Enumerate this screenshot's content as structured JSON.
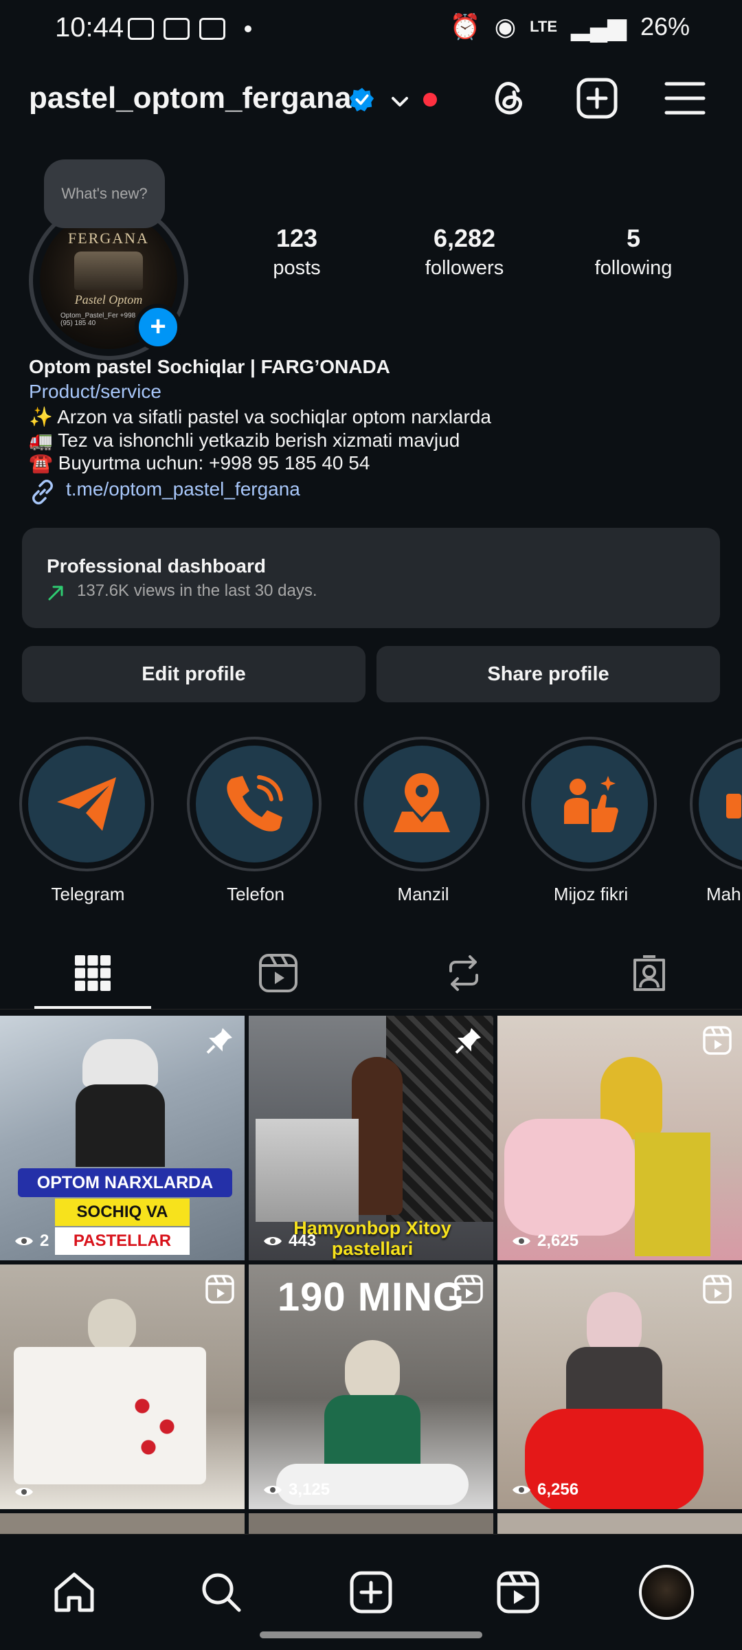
{
  "status_bar": {
    "time": "10:44",
    "network": "LTE",
    "battery": "26%"
  },
  "header": {
    "username": "pastel_optom_fergana",
    "unread_dot_color": "#ff3040"
  },
  "profile": {
    "avatar_brand": "FERGANA",
    "avatar_name": "Pastel Optom",
    "avatar_sub": "Optom_Pastel_Fer +998 (95) 185 40",
    "note_bubble": "What's new?",
    "stats": [
      {
        "value": "123",
        "label": "posts"
      },
      {
        "value": "6,282",
        "label": "followers"
      },
      {
        "value": "5",
        "label": "following"
      }
    ]
  },
  "bio": {
    "name": "Optom pastel Sochiqlar | FARG’ONADA",
    "category": "Product/service",
    "line1": "✨ Arzon va sifatli pastel va sochiqlar optom narxlarda",
    "line2": "🚛 Tez va ishonchli yetkazib berish xizmati mavjud",
    "line3": "☎️ Buyurtma uchun: +998 95 185 40 54",
    "link": "t.me/optom_pastel_fergana"
  },
  "dashboard": {
    "title": "Professional dashboard",
    "subtitle": "137.6K views in the last 30 days."
  },
  "buttons": {
    "edit": "Edit profile",
    "share": "Share profile"
  },
  "highlights": [
    {
      "label": "Telegram",
      "icon": "paper-plane-icon"
    },
    {
      "label": "Telefon",
      "icon": "phone-icon"
    },
    {
      "label": "Manzil",
      "icon": "map-pin-icon"
    },
    {
      "label": "Mijoz fikri",
      "icon": "thumbs-up-icon"
    },
    {
      "label": "Mah",
      "icon": "partial-icon"
    }
  ],
  "tabs": [
    "grid-icon",
    "reels-icon",
    "reposts-icon",
    "tagged-icon"
  ],
  "posts": [
    {
      "views": "2",
      "caption_1": "OPTOM NARXLARDA",
      "caption_2": "SOCHIQ VA",
      "caption_3": "PASTELLAR",
      "badge": "pin-icon"
    },
    {
      "views": "443",
      "caption_1": "Hamyonbop Xitoy",
      "caption_2": "pastellari",
      "badge": "pin-icon"
    },
    {
      "views": "2,625",
      "badge": "reels-icon"
    },
    {
      "views": "",
      "badge": "reels-icon"
    },
    {
      "views": "3,125",
      "caption_1": "190 MING",
      "badge": "reels-icon"
    },
    {
      "views": "6,256",
      "badge": "reels-icon"
    }
  ],
  "colors": {
    "background": "#0c1014",
    "accent_blue": "#0095f6",
    "link_blue": "#a8c7fa",
    "highlight_orange": "#f26b1d"
  }
}
